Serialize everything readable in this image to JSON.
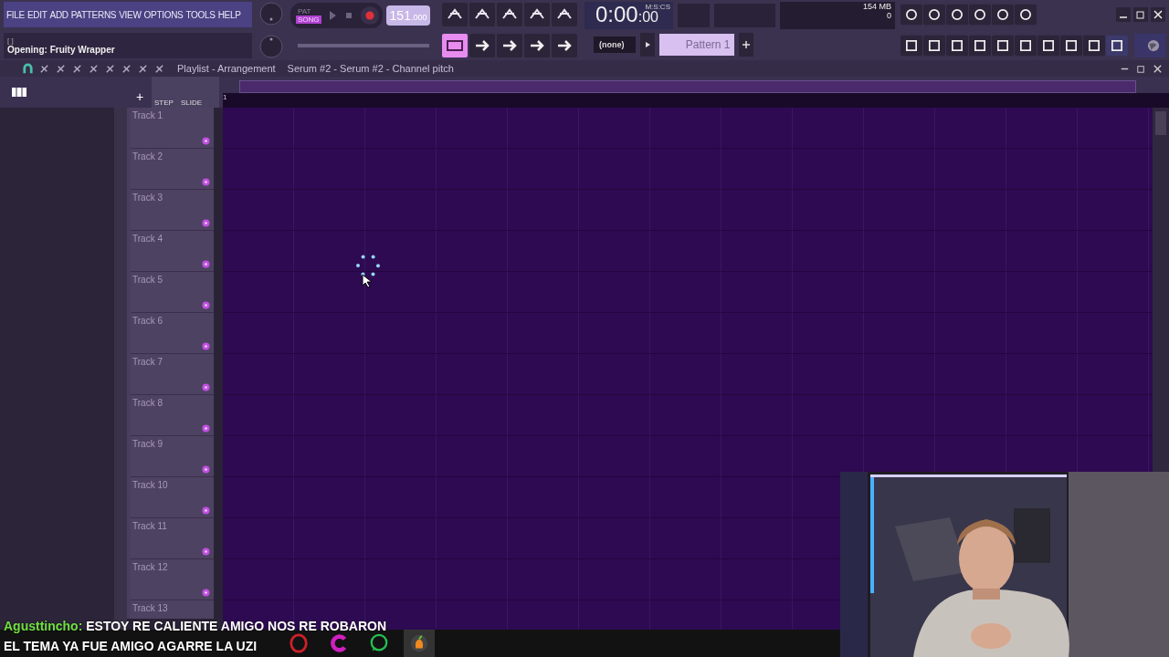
{
  "menu": [
    "FILE",
    "EDIT",
    "ADD",
    "PATTERNS",
    "VIEW",
    "OPTIONS",
    "TOOLS",
    "HELP"
  ],
  "hint": {
    "bracket": "[   ]",
    "status": "Opening: Fruity Wrapper"
  },
  "transport": {
    "modes": [
      {
        "label": "PAT",
        "selected": false
      },
      {
        "label": "SONG",
        "selected": true
      }
    ],
    "tempo": "151",
    "tempo_fraction": ".000"
  },
  "time": {
    "main": "0:00",
    "fraction": ":00",
    "unit": "M:S:CS"
  },
  "memory": {
    "usage": "154 MB",
    "voices": "0"
  },
  "pattern": {
    "channel": "(none)",
    "name": "Pattern 1"
  },
  "playlist": {
    "title": "Playlist - Arrangement",
    "target": "Serum #2 - Serum #2 - Channel pitch",
    "add_label": "+",
    "step_label": "STEP",
    "slide_label": "SLIDE",
    "ruler": "1",
    "tracks": [
      "Track 1",
      "Track 2",
      "Track 3",
      "Track 4",
      "Track 5",
      "Track 6",
      "Track 7",
      "Track 8",
      "Track 9",
      "Track 10",
      "Track 11",
      "Track 12",
      "Track 13"
    ]
  },
  "chat": {
    "user": "Agusttincho:",
    "lines": [
      "ESTOY RE CALIENTE AMIGO NOS RE ROBARON",
      "EL TEMA YA FUE AMIGO AGARRE LA UZI"
    ]
  },
  "taskbar": [
    {
      "kind": "opera",
      "selected": false
    },
    {
      "kind": "c",
      "selected": false
    },
    {
      "kind": "whatsapp",
      "selected": false
    },
    {
      "kind": "fl",
      "selected": true
    }
  ]
}
